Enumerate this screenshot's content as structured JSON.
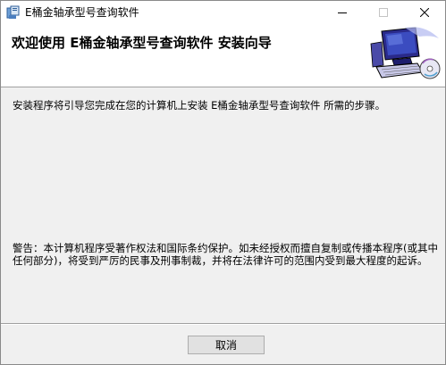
{
  "window": {
    "title": "E桶金轴承型号查询软件",
    "minimize_glyph": "—",
    "maximize_glyph": "☐",
    "close_glyph": "✕"
  },
  "header": {
    "title": "欢迎使用 E桶金轴承型号查询软件 安装向导",
    "graphic_icon": "computer-setup-icon"
  },
  "body": {
    "intro": "安装程序将引导您完成在您的计算机上安装 E桶金轴承型号查询软件 所需的步骤。",
    "warning": "警告：本计算机程序受著作权法和国际条约保护。如未经授权而擅自复制或传播本程序(或其中任何部分)，将受到严厉的民事及刑事制裁，并将在法律许可的范围内受到最大程度的起诉。"
  },
  "footer": {
    "cancel_label": "取消"
  },
  "colors": {
    "window_bg": "#f0f0f0",
    "header_bg": "#ffffff",
    "button_bg": "#e1e1e1"
  }
}
